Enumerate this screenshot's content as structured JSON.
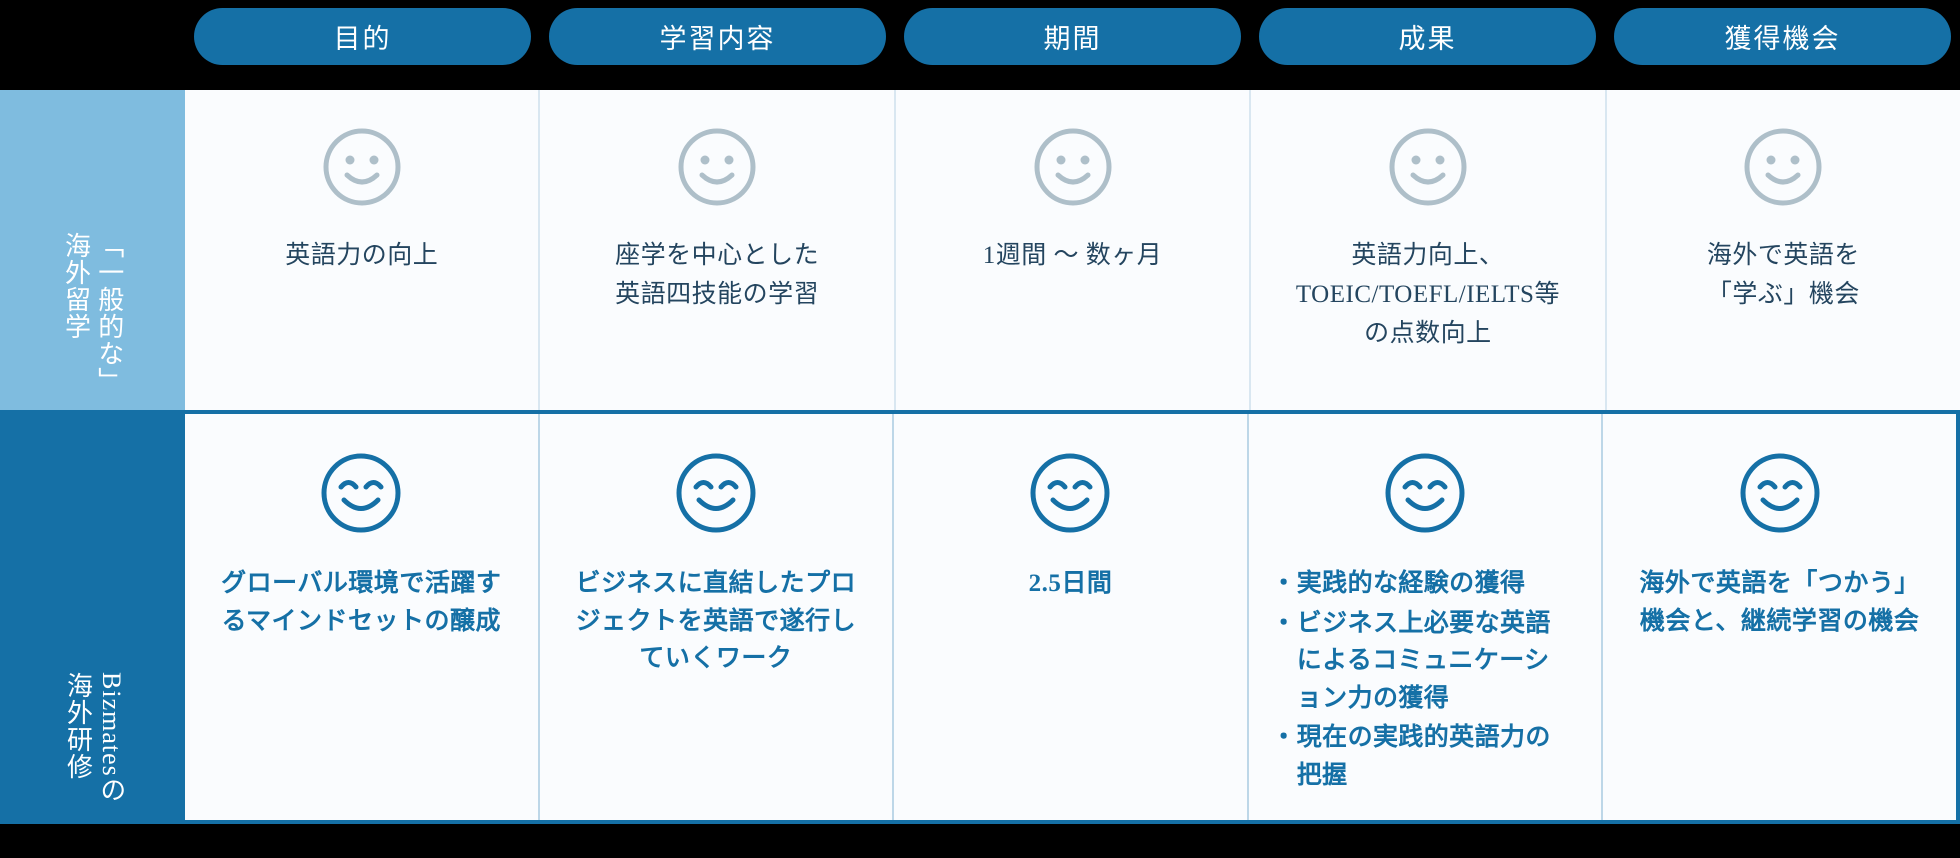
{
  "colors": {
    "pill_blue": "#1570A6",
    "row1_label_blue": "#7FBCDF",
    "row2_label_blue": "#1570A6",
    "cell_bg": "#FAFCFE",
    "row1_text": "#24455F",
    "row2_text": "#1570A6",
    "row1_face": "#AEBFC9",
    "row2_face": "#1570A6",
    "page_bg": "#000000"
  },
  "header": {
    "columns": [
      {
        "label": "目的"
      },
      {
        "label": "学習内容"
      },
      {
        "label": "期間"
      },
      {
        "label": "成果"
      },
      {
        "label": "獲得機会"
      }
    ]
  },
  "rows": [
    {
      "label": "「一般的な」海外留学",
      "label_col_a": "「一般的な」",
      "label_col_b": "海外留学",
      "face": "smiley-neutral-icon",
      "cells": [
        {
          "lines": [
            "英語力の向上"
          ]
        },
        {
          "lines": [
            "座学を中心とした",
            "英語四技能の学習"
          ]
        },
        {
          "lines": [
            "1週間 〜 数ヶ月"
          ]
        },
        {
          "lines": [
            "英語力向上、",
            "TOEIC/TOEFL/IELTS等",
            "の点数向上"
          ]
        },
        {
          "lines": [
            "海外で英語を",
            "「学ぶ」機会"
          ]
        }
      ]
    },
    {
      "label": "Bizmatesの海外研修",
      "label_col_a": "Bizmatesの",
      "label_col_b": "海外研修",
      "face": "smiley-happy-icon",
      "cells": [
        {
          "lines": [
            "グローバル環境で活躍す",
            "るマインドセットの醸成"
          ]
        },
        {
          "lines": [
            "ビジネスに直結したプロ",
            "ジェクトを英語で遂行し",
            "ていくワーク"
          ]
        },
        {
          "lines": [
            "2.5日間"
          ]
        },
        {
          "bullets": [
            {
              "marker": "・",
              "lines": [
                "実践的な経験の獲得"
              ]
            },
            {
              "marker": "・",
              "lines": [
                "ビジネス上必要な英語",
                "によるコミュニケーシ",
                "ョン力の獲得"
              ]
            },
            {
              "marker": "・",
              "lines": [
                "現在の実践的英語力の",
                "把握"
              ]
            }
          ]
        },
        {
          "lines": [
            "海外で英語を「つかう」",
            "機会と、継続学習の機会"
          ]
        }
      ]
    }
  ]
}
